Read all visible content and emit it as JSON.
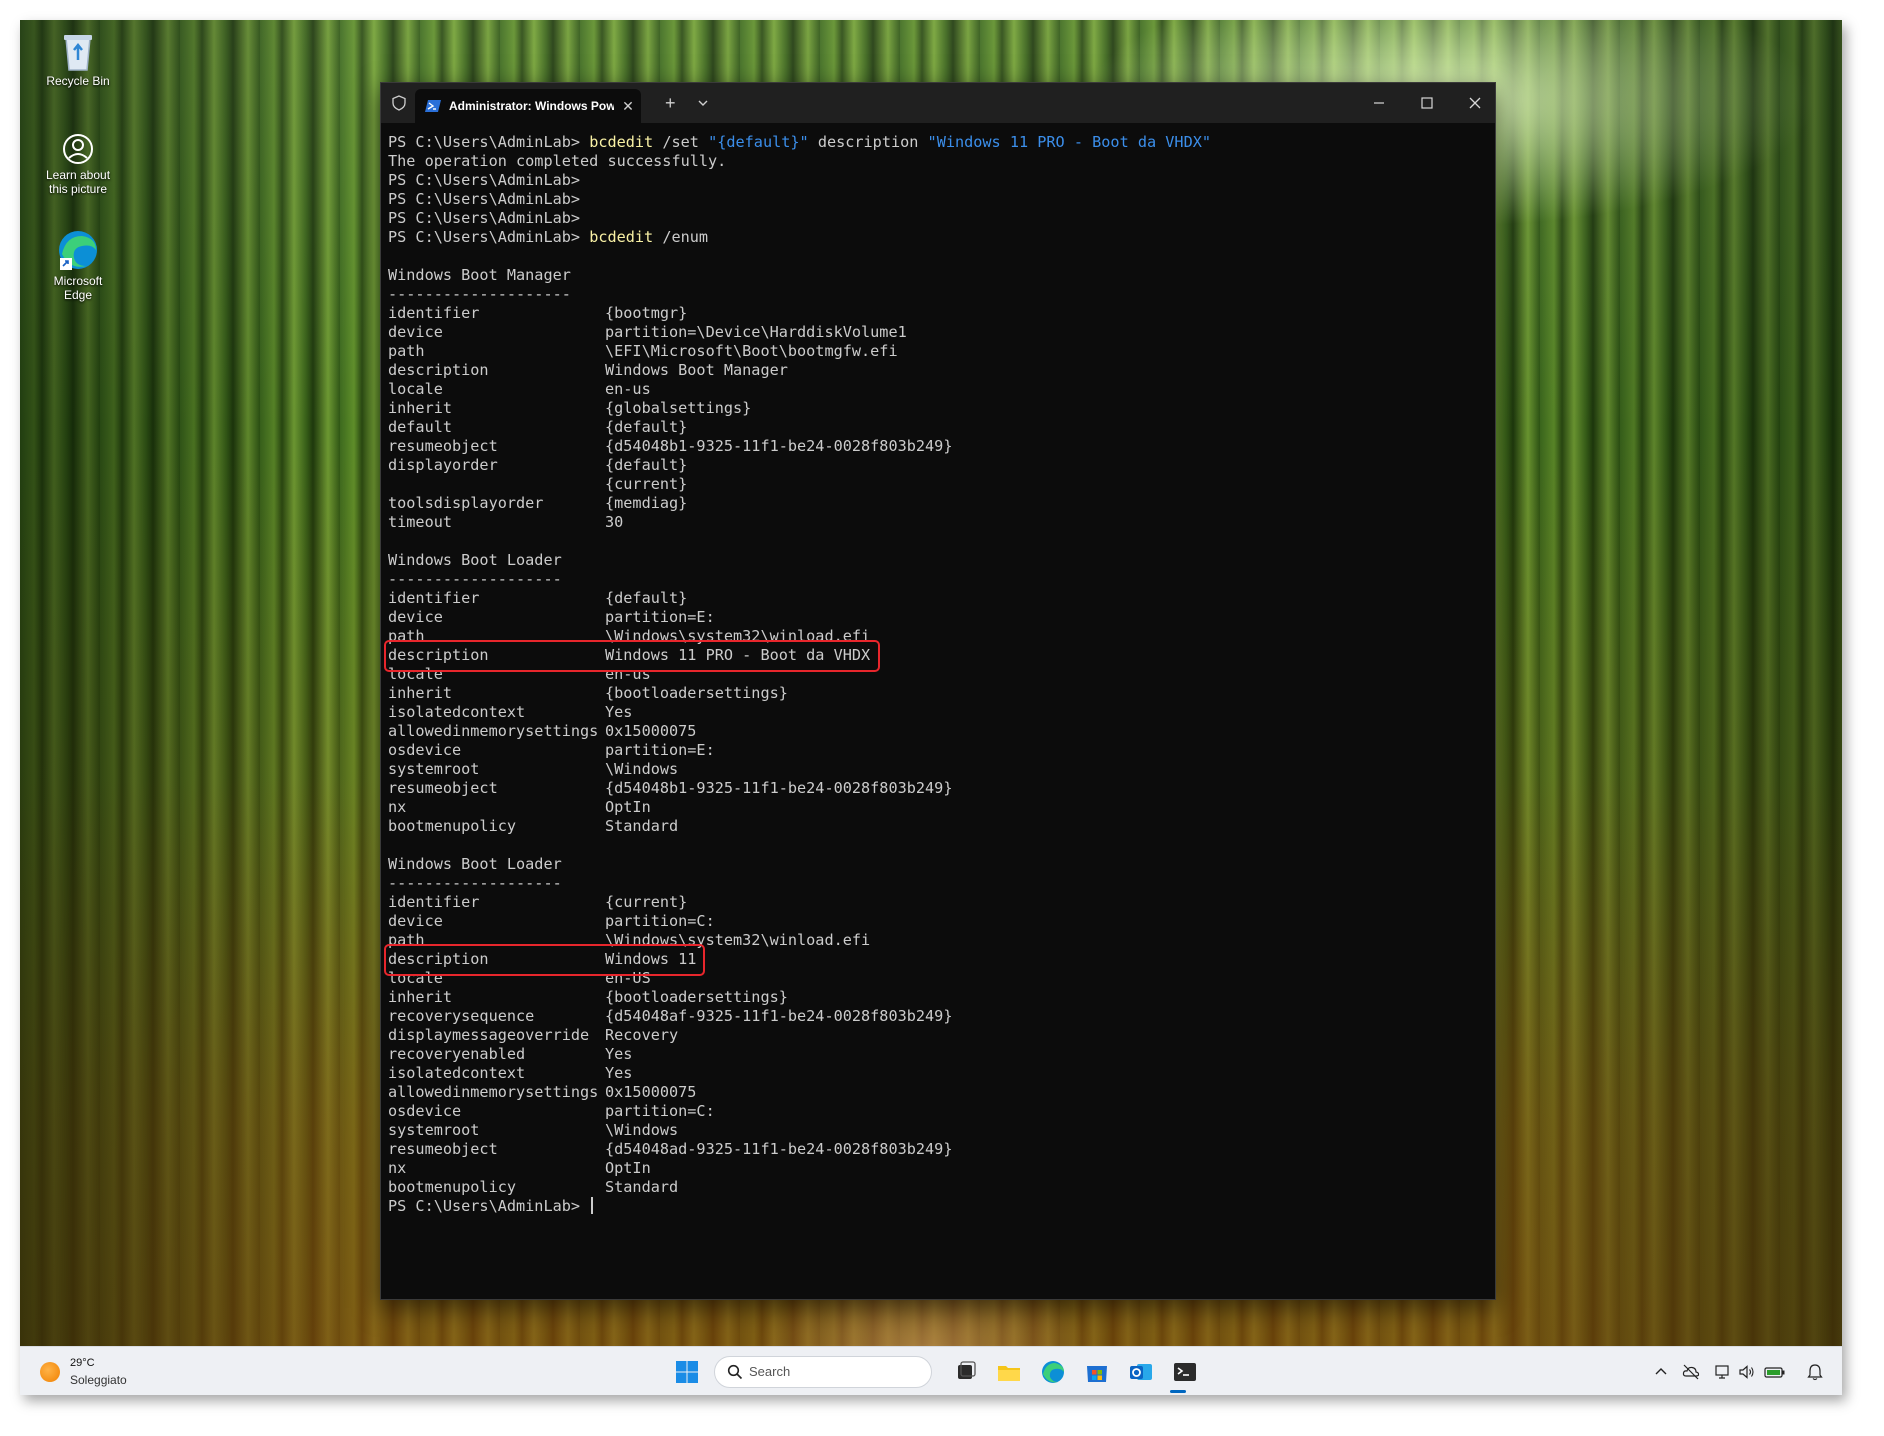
{
  "desktop": {
    "icons": [
      {
        "name": "recycle-bin",
        "label": "Recycle Bin"
      },
      {
        "name": "learn-about-picture",
        "label": "Learn about this picture"
      },
      {
        "name": "microsoft-edge",
        "label": "Microsoft Edge"
      }
    ]
  },
  "terminal": {
    "tab_title": "Administrator: Windows Powe",
    "prompt": "PS C:\\Users\\AdminLab>",
    "lines": {
      "l1_cmd": "bcdedit",
      "l1_args": " /set ",
      "l1_str1": "\"{default}\"",
      "l1_mid": " description ",
      "l1_str2": "\"Windows 11 PRO - Boot da VHDX\"",
      "l2": "The operation completed successfully.",
      "l6_cmd": "bcdedit",
      "l6_args": " /enum"
    },
    "sections": [
      {
        "title": "Windows Boot Manager",
        "underline": "--------------------",
        "rows": [
          {
            "k": "identifier",
            "v": "{bootmgr}"
          },
          {
            "k": "device",
            "v": "partition=\\Device\\HarddiskVolume1"
          },
          {
            "k": "path",
            "v": "\\EFI\\Microsoft\\Boot\\bootmgfw.efi"
          },
          {
            "k": "description",
            "v": "Windows Boot Manager"
          },
          {
            "k": "locale",
            "v": "en-us"
          },
          {
            "k": "inherit",
            "v": "{globalsettings}"
          },
          {
            "k": "default",
            "v": "{default}"
          },
          {
            "k": "resumeobject",
            "v": "{d54048b1-9325-11f1-be24-0028f803b249}"
          },
          {
            "k": "displayorder",
            "v": "{default}"
          },
          {
            "k": "",
            "v": "{current}"
          },
          {
            "k": "toolsdisplayorder",
            "v": "{memdiag}"
          },
          {
            "k": "timeout",
            "v": "30"
          }
        ]
      },
      {
        "title": "Windows Boot Loader",
        "underline": "-------------------",
        "rows": [
          {
            "k": "identifier",
            "v": "{default}"
          },
          {
            "k": "device",
            "v": "partition=E:"
          },
          {
            "k": "path",
            "v": "\\Windows\\system32\\winload.efi"
          },
          {
            "k": "description",
            "v": "Windows 11 PRO - Boot da VHDX"
          },
          {
            "k": "locale",
            "v": "en-us"
          },
          {
            "k": "inherit",
            "v": "{bootloadersettings}"
          },
          {
            "k": "isolatedcontext",
            "v": "Yes"
          },
          {
            "k": "allowedinmemorysettings",
            "v": "0x15000075"
          },
          {
            "k": "osdevice",
            "v": "partition=E:"
          },
          {
            "k": "systemroot",
            "v": "\\Windows"
          },
          {
            "k": "resumeobject",
            "v": "{d54048b1-9325-11f1-be24-0028f803b249}"
          },
          {
            "k": "nx",
            "v": "OptIn"
          },
          {
            "k": "bootmenupolicy",
            "v": "Standard"
          }
        ]
      },
      {
        "title": "Windows Boot Loader",
        "underline": "-------------------",
        "rows": [
          {
            "k": "identifier",
            "v": "{current}"
          },
          {
            "k": "device",
            "v": "partition=C:"
          },
          {
            "k": "path",
            "v": "\\Windows\\system32\\winload.efi"
          },
          {
            "k": "description",
            "v": "Windows 11"
          },
          {
            "k": "locale",
            "v": "en-US"
          },
          {
            "k": "inherit",
            "v": "{bootloadersettings}"
          },
          {
            "k": "recoverysequence",
            "v": "{d54048af-9325-11f1-be24-0028f803b249}"
          },
          {
            "k": "displaymessageoverride",
            "v": "Recovery"
          },
          {
            "k": "recoveryenabled",
            "v": "Yes"
          },
          {
            "k": "isolatedcontext",
            "v": "Yes"
          },
          {
            "k": "allowedinmemorysettings",
            "v": "0x15000075"
          },
          {
            "k": "osdevice",
            "v": "partition=C:"
          },
          {
            "k": "systemroot",
            "v": "\\Windows"
          },
          {
            "k": "resumeobject",
            "v": "{d54048ad-9325-11f1-be24-0028f803b249}"
          },
          {
            "k": "nx",
            "v": "OptIn"
          },
          {
            "k": "bootmenupolicy",
            "v": "Standard"
          }
        ]
      }
    ]
  },
  "taskbar": {
    "weather_temp": "29°C",
    "weather_desc": "Soleggiato",
    "search_placeholder": "Search"
  },
  "colors": {
    "highlight_box": "#e8262c",
    "command": "#f9f1a5",
    "string": "#3b8eea",
    "terminal_bg": "#0c0c0c",
    "text": "#cccccc"
  }
}
